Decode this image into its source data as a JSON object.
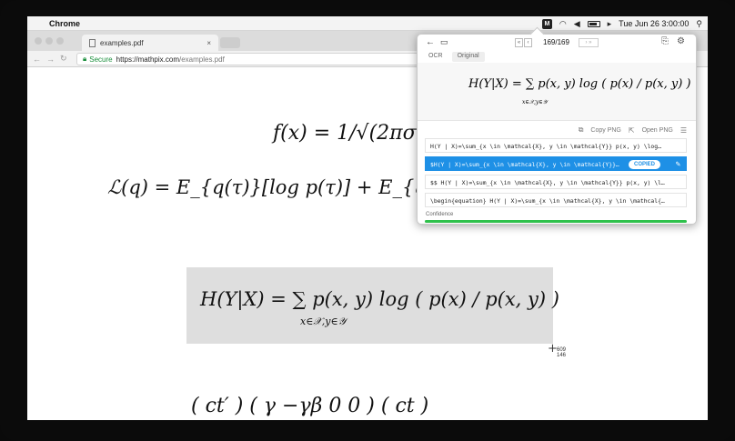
{
  "menubar": {
    "app_name": "Chrome",
    "clock": "Tue Jun 26  3:00:00",
    "mathpix_glyph": "M"
  },
  "browser": {
    "tab_title": "examples.pdf",
    "tab_close": "×",
    "secure_label": "Secure",
    "url_host": "https://mathpix.com",
    "url_path": "/examples.pdf"
  },
  "pdf": {
    "eq1": "f(x) = 1/√(2πσx) e",
    "eq2": "ℒ(q) = E_{q(τ)}[log p(τ)] + E_{q(θ)}[log p(θ",
    "eq3": "H(Y|X) =  ∑  p(x, y) log ( p(x) / p(x, y) )",
    "eq3_sub": "x∈𝒳,y∈𝒴",
    "eq4": "( ct′ )      (   γ      −γβ   0   0 ) ( ct )",
    "cursor_x": "609",
    "cursor_y": "146"
  },
  "popup": {
    "page_counter": "169/169",
    "tabs": [
      {
        "label": "OCR"
      },
      {
        "label": "Original"
      }
    ],
    "preview_eq": "H(Y|X) =   ∑   p(x, y) log ( p(x) / p(x, y) )",
    "preview_sub": "x∈𝒳,y∈𝒴",
    "copy_png": "Copy PNG",
    "open_png": "Open PNG",
    "latex_rows": [
      {
        "text": "H(Y | X)=\\sum_{x \\in \\mathcal{X}, y \\in \\mathcal{Y}} p(x, y) \\log…"
      },
      {
        "text": "$H(Y | X)=\\sum_{x \\in \\mathcal{X}, y \\in \\mathcal{Y}}…"
      },
      {
        "text": "$$ H(Y | X)=\\sum_{x \\in \\mathcal{X}, y \\in \\mathcal{Y}} p(x, y) \\l…"
      },
      {
        "text": "\\begin{equation} H(Y | X)=\\sum_{x \\in \\mathcal{X}, y \\in \\mathcal{…"
      }
    ],
    "copied_label": "COPIED",
    "confidence_label": "Confidence",
    "confidence_pct": 100
  },
  "colors": {
    "accent": "#1e90e6",
    "confidence": "#2ec14b",
    "secure": "#1a8f3c"
  }
}
